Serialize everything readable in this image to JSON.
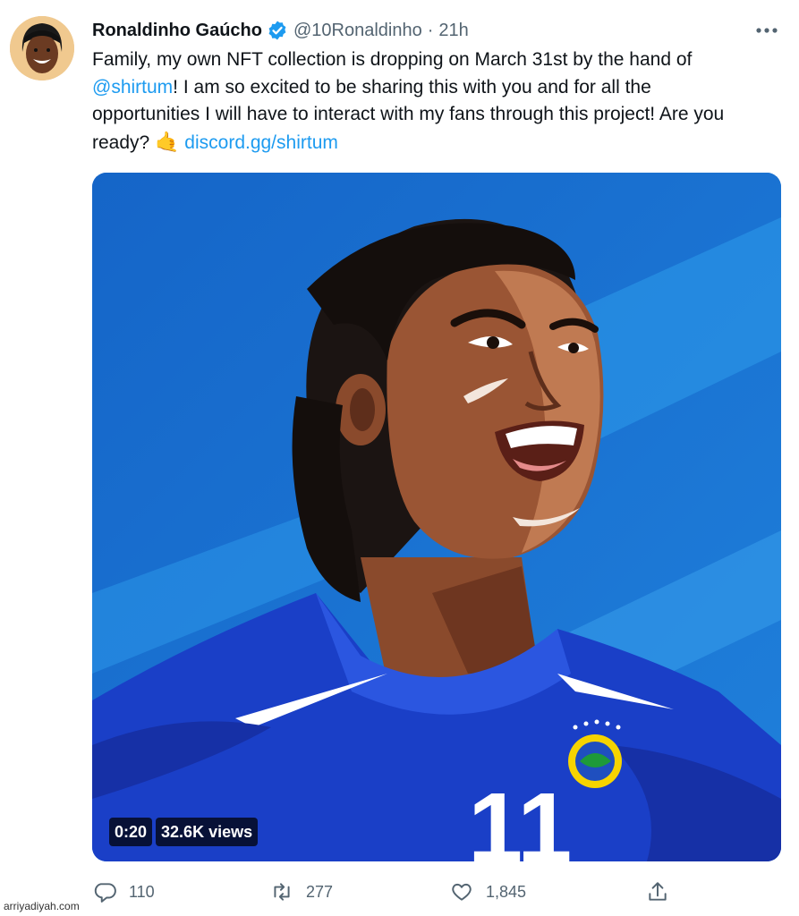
{
  "tweet": {
    "author_name": "Ronaldinho Gaúcho",
    "handle": "@10Ronaldinho",
    "separator": "·",
    "time": "21h",
    "more_label": "•••",
    "text": {
      "part1": "Family, my own NFT collection is dropping on March 31st by the hand of ",
      "mention": "@shirtum",
      "part2": "! I am so excited to be sharing this with you and for all the opportunities I will have to interact with my fans through this project! Are you ready? ",
      "emoji": "🤙",
      "link": "discord.gg/shirtum"
    },
    "media": {
      "duration": "0:20",
      "views": "32.6K views",
      "jersey_number": "11"
    },
    "actions": {
      "reply_count": "110",
      "retweet_count": "277",
      "like_count": "1,845"
    }
  },
  "watermark": "arriyadiyah.com",
  "colors": {
    "link": "#1d9bf0",
    "verified": "#1d9bf0",
    "secondary_text": "#536471",
    "media_bg": "#1a6fd0"
  },
  "icons": {
    "verified": "verified-badge-icon",
    "more": "more-icon",
    "reply": "reply-icon",
    "retweet": "retweet-icon",
    "like": "heart-icon",
    "share": "share-icon"
  }
}
